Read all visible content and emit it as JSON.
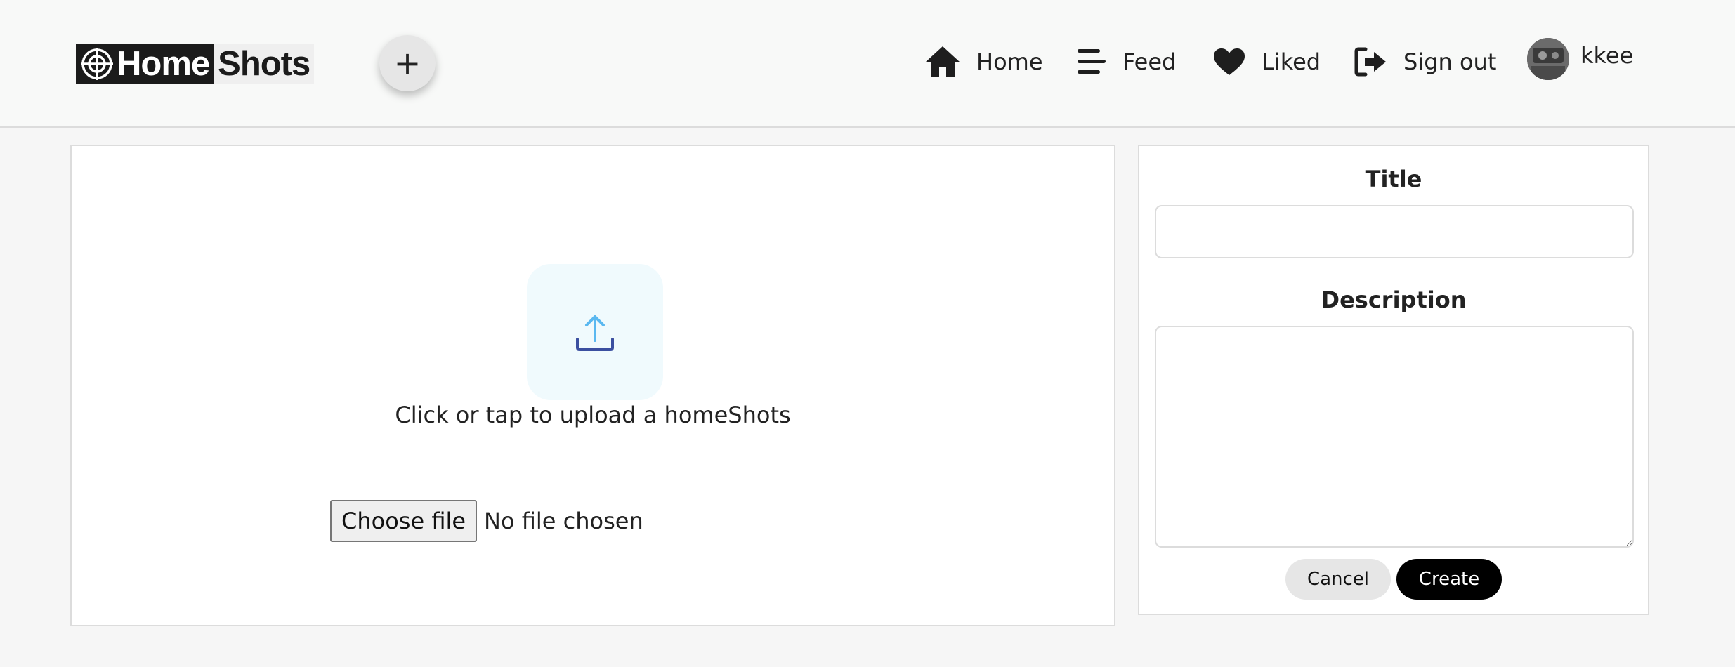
{
  "header": {
    "logo": {
      "part1": "Home",
      "part2": "Shots"
    },
    "add_button": "+",
    "nav": [
      {
        "label": "Home",
        "icon": "home-icon"
      },
      {
        "label": "Feed",
        "icon": "feed-icon"
      },
      {
        "label": "Liked",
        "icon": "heart-icon"
      },
      {
        "label": "Sign out",
        "icon": "sign-out-icon"
      }
    ],
    "user": {
      "name": "kkee"
    }
  },
  "upload": {
    "prompt": "Click or tap to upload a homeShots",
    "file_button": "Choose file",
    "file_status": "No file chosen",
    "icon_color": "#5ab8f0",
    "tray_color": "#3b4fa0"
  },
  "form": {
    "title_label": "Title",
    "title_value": "",
    "description_label": "Description",
    "description_value": "",
    "cancel_label": "Cancel",
    "create_label": "Create"
  }
}
